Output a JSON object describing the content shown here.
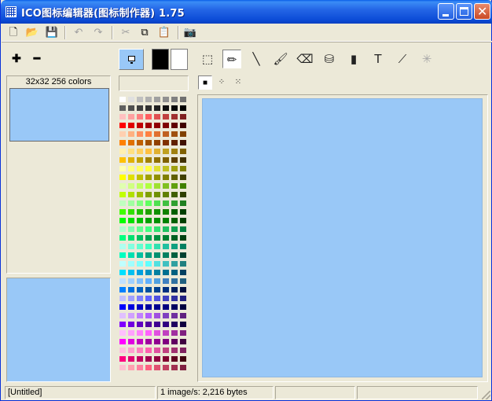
{
  "window": {
    "title": "ICO图标编辑器(图标制作器) 1.75",
    "icons": {
      "app": "grid-app-icon",
      "minimize": "minimize-icon",
      "maximize": "maximize-icon",
      "close": "close-icon"
    }
  },
  "toolbar": {
    "glyphs": {
      "new": "🗋",
      "open": "📂",
      "save": "💾",
      "undo": "↶",
      "redo": "↷",
      "cut": "✂",
      "copy": "⧉",
      "paste": "📋",
      "capture": "📷"
    },
    "disabled": [
      "undo",
      "redo",
      "cut",
      "paste"
    ]
  },
  "left_panel": {
    "add_glyph": "✚",
    "remove_glyph": "━",
    "size_label": "32x32 256 colors",
    "thumb_color": "#99c8f7",
    "preview_color": "#99c8f7"
  },
  "colors": {
    "foreground": "#000000",
    "background": "#ffffff",
    "mode_icon": "monitor-icon",
    "palette_rows": [
      [
        "#ffffff",
        "#e0e0e0",
        "#c0c0c0",
        "#b0b0b0",
        "#a0a0a0",
        "#909090",
        "#808080",
        "#707070"
      ],
      [
        "#606060",
        "#505050",
        "#404040",
        "#303030",
        "#202020",
        "#101010",
        "#080808",
        "#000000"
      ],
      [
        "#ffc0c0",
        "#ffa0a0",
        "#ff8080",
        "#ff6060",
        "#e05050",
        "#c04040",
        "#a03030",
        "#802020"
      ],
      [
        "#ff0000",
        "#e00000",
        "#c00000",
        "#a00000",
        "#900000",
        "#800000",
        "#600000",
        "#400000"
      ],
      [
        "#ffd0b0",
        "#ffb080",
        "#ff9060",
        "#ff8040",
        "#e07030",
        "#c06020",
        "#a05010",
        "#804000"
      ],
      [
        "#ff8000",
        "#e07000",
        "#c06000",
        "#a05000",
        "#904000",
        "#803000",
        "#602000",
        "#401000"
      ],
      [
        "#fff0b0",
        "#ffe080",
        "#ffd060",
        "#ffc040",
        "#e0b030",
        "#c0a020",
        "#a08010",
        "#806000"
      ],
      [
        "#ffc000",
        "#e0b000",
        "#c0a000",
        "#a08000",
        "#907000",
        "#806000",
        "#604000",
        "#403000"
      ],
      [
        "#ffffb0",
        "#ffff80",
        "#ffff60",
        "#ffff40",
        "#e0e030",
        "#c0c020",
        "#a0a010",
        "#808000"
      ],
      [
        "#ffff00",
        "#e0e000",
        "#c0c000",
        "#a0a000",
        "#909000",
        "#808000",
        "#606000",
        "#404000"
      ],
      [
        "#e0ffb0",
        "#d0ff80",
        "#c0ff60",
        "#b0ff40",
        "#a0e030",
        "#80c020",
        "#60a010",
        "#408000"
      ],
      [
        "#c0ff00",
        "#b0e000",
        "#a0c000",
        "#80a000",
        "#709000",
        "#608000",
        "#406000",
        "#304000"
      ],
      [
        "#c0ffc0",
        "#a0ffa0",
        "#80ff80",
        "#60ff60",
        "#50e050",
        "#40c040",
        "#30a030",
        "#208020"
      ],
      [
        "#40ff00",
        "#30e000",
        "#20c000",
        "#20a000",
        "#109000",
        "#108000",
        "#006000",
        "#004000"
      ],
      [
        "#00ff00",
        "#00e000",
        "#00c000",
        "#00a000",
        "#009000",
        "#008000",
        "#006000",
        "#004000"
      ],
      [
        "#b0ffd0",
        "#80ffb0",
        "#60ff90",
        "#40ff80",
        "#30e070",
        "#20c060",
        "#10a050",
        "#008040"
      ],
      [
        "#00ff80",
        "#00e070",
        "#00c060",
        "#00a050",
        "#009040",
        "#008030",
        "#006020",
        "#004010"
      ],
      [
        "#b0fff0",
        "#80ffe0",
        "#60ffd0",
        "#40ffc0",
        "#30e0b0",
        "#20c0a0",
        "#10a080",
        "#008060"
      ],
      [
        "#00ffc0",
        "#00e0b0",
        "#00c0a0",
        "#00a080",
        "#009070",
        "#008060",
        "#006040",
        "#004030"
      ],
      [
        "#c0ffff",
        "#a0ffff",
        "#80ffff",
        "#60ffff",
        "#50e0e0",
        "#40c0c0",
        "#30a0a0",
        "#208080"
      ],
      [
        "#00e0ff",
        "#00c0f0",
        "#00a0e0",
        "#0090c0",
        "#0080a0",
        "#007090",
        "#006080",
        "#004060"
      ],
      [
        "#c0e0ff",
        "#a0d0ff",
        "#80c0ff",
        "#60b0ff",
        "#50a0e0",
        "#4080c0",
        "#3070a0",
        "#206080"
      ],
      [
        "#0080ff",
        "#0070e0",
        "#0060c0",
        "#0050a0",
        "#004090",
        "#003080",
        "#002060",
        "#001040"
      ],
      [
        "#c0c0ff",
        "#a0a0ff",
        "#8080ff",
        "#6060ff",
        "#5050e0",
        "#4040c0",
        "#3030a0",
        "#202080"
      ],
      [
        "#0000ff",
        "#0000e0",
        "#0000c0",
        "#0000a0",
        "#000090",
        "#000080",
        "#000060",
        "#000040"
      ],
      [
        "#e0c0ff",
        "#d0a0ff",
        "#c080ff",
        "#b060ff",
        "#a050e0",
        "#8040c0",
        "#7030a0",
        "#602080"
      ],
      [
        "#8000ff",
        "#7000e0",
        "#6000c0",
        "#5000a0",
        "#400090",
        "#300080",
        "#200060",
        "#100040"
      ],
      [
        "#ffc0ff",
        "#ffa0ff",
        "#ff80ff",
        "#ff60ff",
        "#e050e0",
        "#c040c0",
        "#a030a0",
        "#802080"
      ],
      [
        "#ff00ff",
        "#e000e0",
        "#c000c0",
        "#a000a0",
        "#900090",
        "#800080",
        "#600060",
        "#400040"
      ],
      [
        "#ffc0e0",
        "#ffa0d0",
        "#ff80c0",
        "#ff60b0",
        "#e050a0",
        "#c04080",
        "#a03070",
        "#802060"
      ],
      [
        "#ff0080",
        "#e00070",
        "#c00060",
        "#a00050",
        "#900040",
        "#800030",
        "#600020",
        "#400010"
      ],
      [
        "#ffc0d0",
        "#ffa0b0",
        "#ff80a0",
        "#ff6080",
        "#e05070",
        "#c04060",
        "#a03050",
        "#802040"
      ]
    ]
  },
  "tools": {
    "items": [
      {
        "name": "select-tool",
        "glyph": "⬚"
      },
      {
        "name": "pencil-tool",
        "glyph": "✏"
      },
      {
        "name": "line-tool",
        "glyph": "╲"
      },
      {
        "name": "brush-tool",
        "glyph": "🖌"
      },
      {
        "name": "eraser-tool",
        "glyph": "⌫"
      },
      {
        "name": "fill-tool",
        "glyph": "⛁"
      },
      {
        "name": "bucket-tool",
        "glyph": "▮"
      },
      {
        "name": "text-tool",
        "glyph": "T"
      },
      {
        "name": "eyedropper-tool",
        "glyph": "⟋"
      },
      {
        "name": "magic-tool",
        "glyph": "✳"
      }
    ],
    "active": "pencil-tool",
    "brushes": [
      "■",
      "⁘",
      "⁙"
    ]
  },
  "canvas": {
    "color": "#99c8f7"
  },
  "status": {
    "file": "[Untitled]",
    "images": "1 image/s: 2,216 bytes",
    "pane3": "",
    "pane4": ""
  }
}
